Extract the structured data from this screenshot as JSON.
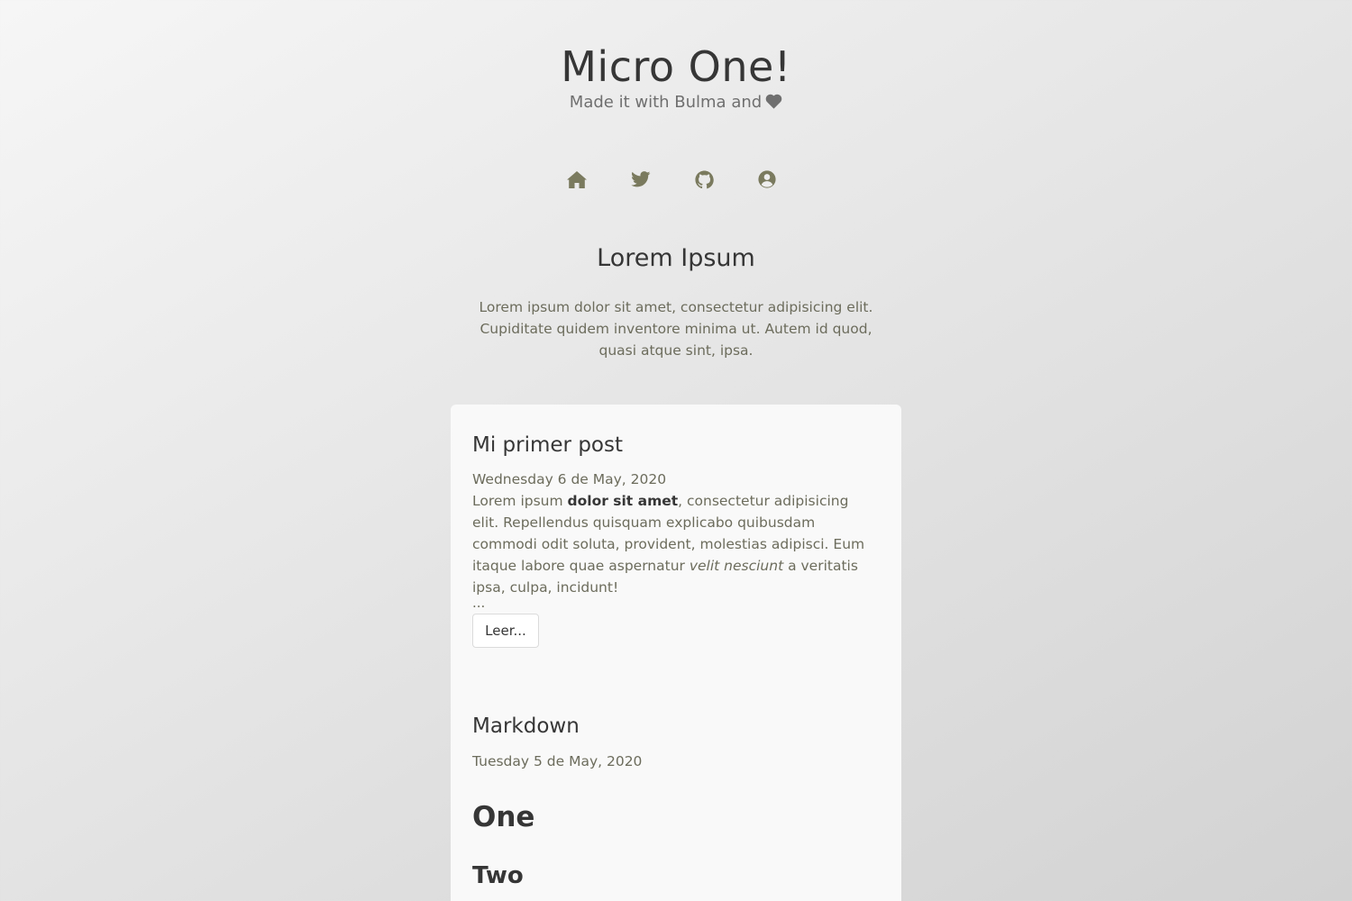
{
  "header": {
    "title": "Micro One!",
    "subtitle": "Made it with Bulma and"
  },
  "social_icons": [
    "home-icon",
    "twitter-icon",
    "github-icon",
    "user-circle-icon"
  ],
  "icon_color": "#7a7a5e",
  "intro": {
    "title": "Lorem Ipsum",
    "text": "Lorem ipsum dolor sit amet, consectetur adipisicing elit. Cupiditate quidem inventore minima ut. Autem id quod, quasi atque sint, ipsa."
  },
  "posts": [
    {
      "title": "Mi primer post",
      "date": "Wednesday 6 de May, 2020",
      "body_1": "Lorem ipsum ",
      "body_bold": "dolor sit amet",
      "body_2": ", consectetur adipisicing elit. Repellendus quisquam explicabo quibusdam commodi odit soluta, provident, molestias adipisci. Eum itaque labore quae aspernatur ",
      "body_italic": "velit nesciunt",
      "body_3": " a veritatis ipsa, culpa, incidunt!",
      "ellipsis": "...",
      "read_more": "Leer..."
    },
    {
      "title": "Markdown",
      "date": "Tuesday 5 de May, 2020",
      "heading_1": "One",
      "heading_2": "Two"
    }
  ]
}
